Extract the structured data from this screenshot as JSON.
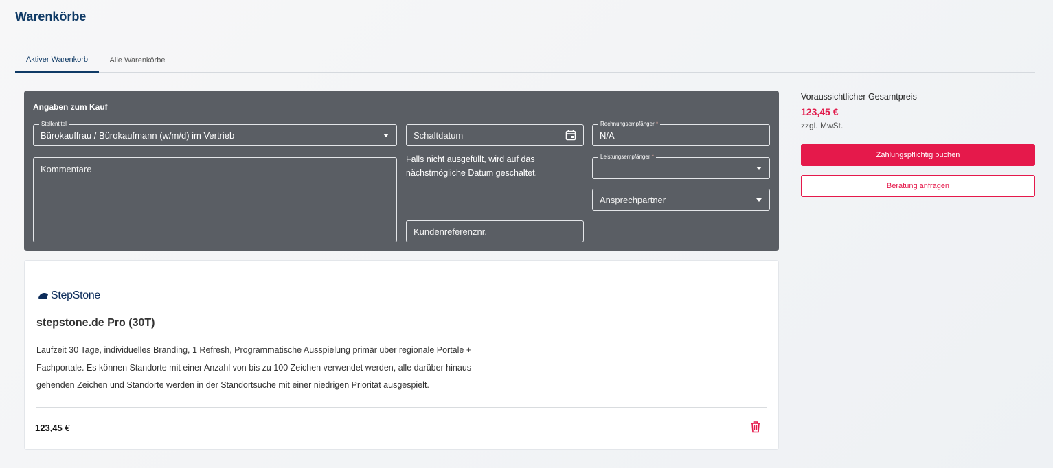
{
  "page": {
    "title": "Warenkörbe"
  },
  "tabs": [
    {
      "label": "Aktiver Warenkorb",
      "active": true
    },
    {
      "label": "Alle Warenkörbe",
      "active": false
    }
  ],
  "form": {
    "title": "Angaben zum Kauf",
    "stellentitel": {
      "label": "Stellentitel",
      "value": "Bürokauffrau / Bürokaufmann (w/m/d) im Vertrieb"
    },
    "schaltdatum": {
      "placeholder": "Schaltdatum",
      "hint": "Falls nicht ausgefüllt, wird auf das nächstmögliche Datum geschaltet."
    },
    "rechnungsempfaenger": {
      "label": "Rechnungsempfänger",
      "required_mark": "*",
      "value": "N/A"
    },
    "kommentare": {
      "placeholder": "Kommentare"
    },
    "leistungsempfaenger": {
      "label": "Leistungsempfänger",
      "required_mark": "*",
      "value": ""
    },
    "ansprechpartner": {
      "placeholder": "Ansprechpartner"
    },
    "kundenreferenz": {
      "placeholder": "Kundenreferenznr."
    }
  },
  "product": {
    "brand": "StepStone",
    "title": "stepstone.de Pro (30T)",
    "description": "Laufzeit 30 Tage, individuelles Branding, 1 Refresh, Programmatische Ausspielung primär über regionale Portale + Fachportale. Es können Standorte mit einer Anzahl von bis zu 100 Zeichen verwendet werden, alle darüber hinaus gehenden Zeichen und Standorte werden in der Standortsuche mit einer niedrigen Priorität ausgespielt.",
    "price": "123,45",
    "currency": "€"
  },
  "summary": {
    "label": "Voraussichtlicher Gesamtpreis",
    "total": "123,45 €",
    "vat_note": "zzgl. MwSt.",
    "book_button": "Zahlungspflichtig buchen",
    "consult_button": "Beratung anfragen"
  },
  "colors": {
    "accent": "#e5194b",
    "brand_navy": "#0f3a66",
    "panel": "#5a5e64"
  },
  "icons": {
    "date": "calendar-icon",
    "dropdown": "chevron-down-icon",
    "delete": "trash-icon",
    "logo": "stepstone-logo-icon"
  }
}
